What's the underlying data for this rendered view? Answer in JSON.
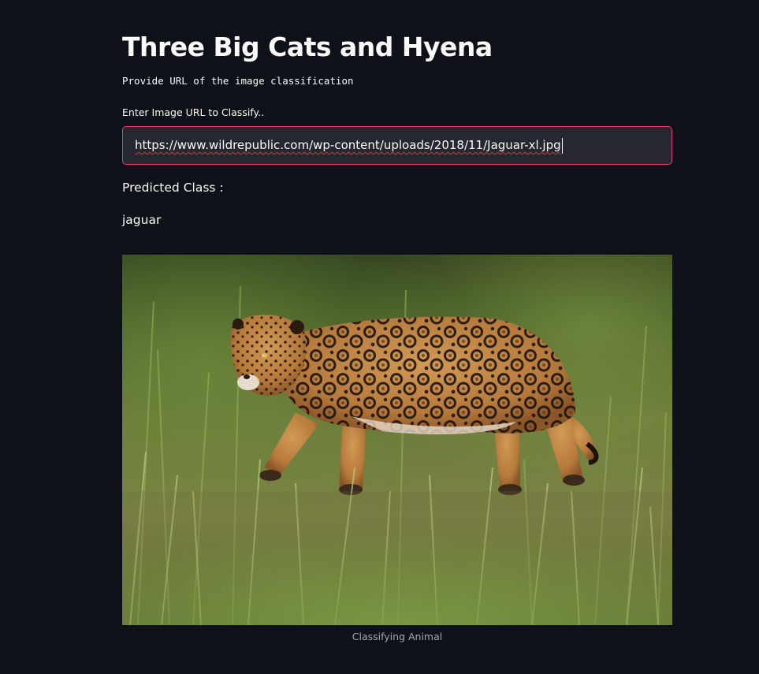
{
  "app": {
    "title": "Three Big Cats and Hyena",
    "subtitle": "Provide URL of the image classification"
  },
  "url_input": {
    "label": "Enter Image URL to Classify..",
    "value": "https://www.wildrepublic.com/wp-content/uploads/2018/11/Jaguar-xl.jpg"
  },
  "prediction": {
    "label": "Predicted Class :",
    "value": "jaguar"
  },
  "image": {
    "caption": "Classifying Animal"
  },
  "colors": {
    "background": "#0e1117",
    "input_background": "#262730",
    "input_focus_border": "#e0436b",
    "text": "#fafafa",
    "caption_text": "#a3a8b4"
  }
}
